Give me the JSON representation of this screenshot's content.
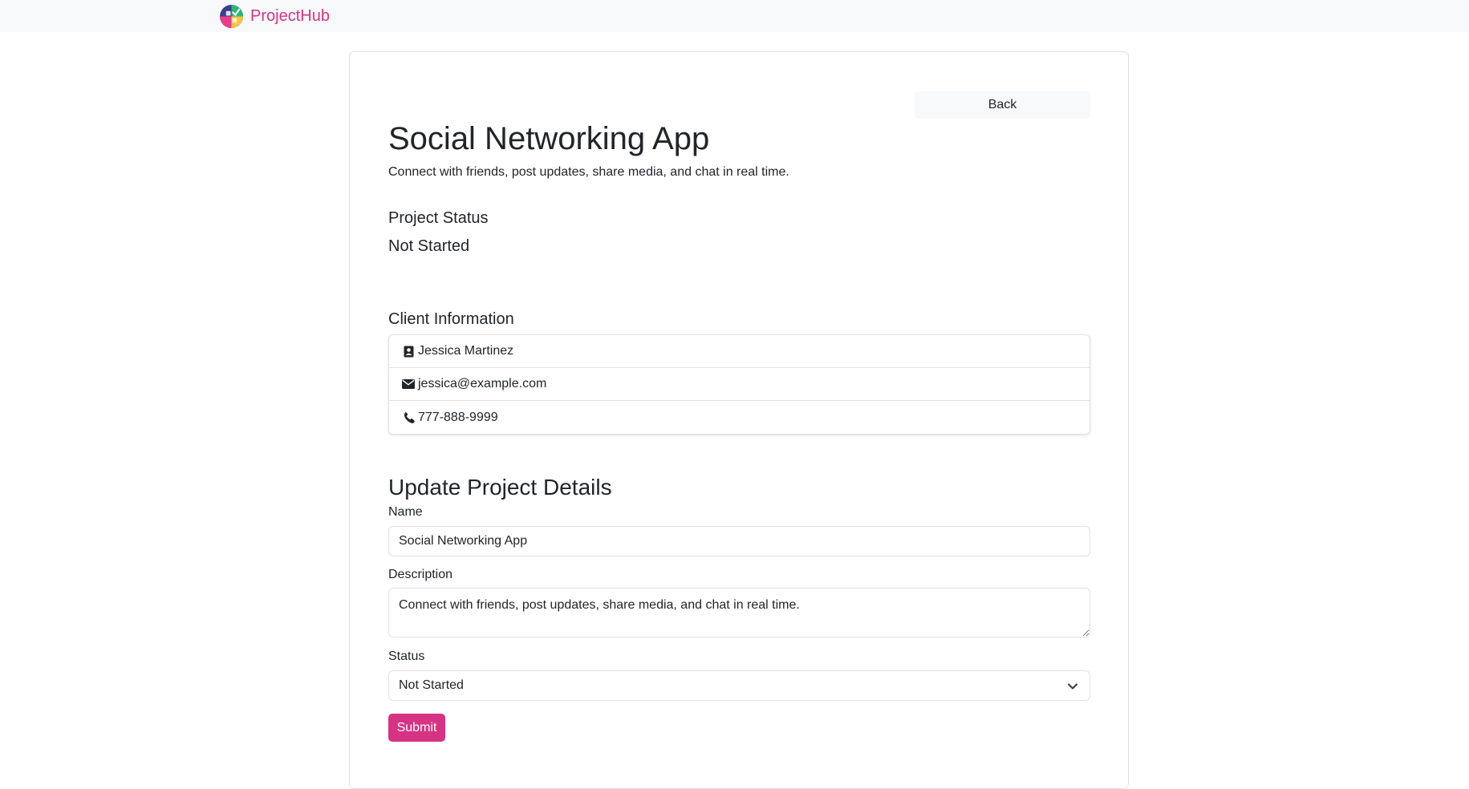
{
  "navbar": {
    "brand": "ProjectHub",
    "logo_icon": "projecthub-logo"
  },
  "project": {
    "back_label": "Back",
    "title": "Social Networking App",
    "description": "Connect with friends, post updates, share media, and chat in real time."
  },
  "status_section": {
    "heading": "Project Status",
    "value": "Not Started"
  },
  "client_section": {
    "heading": "Client Information",
    "items": [
      {
        "icon": "contact-card-icon",
        "value": "Jessica Martinez"
      },
      {
        "icon": "envelope-icon",
        "value": "jessica@example.com"
      },
      {
        "icon": "phone-icon",
        "value": "777-888-9999"
      }
    ]
  },
  "update_form": {
    "heading": "Update Project Details",
    "name_label": "Name",
    "name_value": "Social Networking App",
    "description_label": "Description",
    "description_value": "Connect with friends, post updates, share media, and chat in real time.",
    "status_label": "Status",
    "status_value": "Not Started",
    "submit_label": "Submit"
  },
  "colors": {
    "accent": "#d63384",
    "navbar_bg": "#f8f9fa",
    "border": "#dee2e6",
    "text": "#212529"
  }
}
